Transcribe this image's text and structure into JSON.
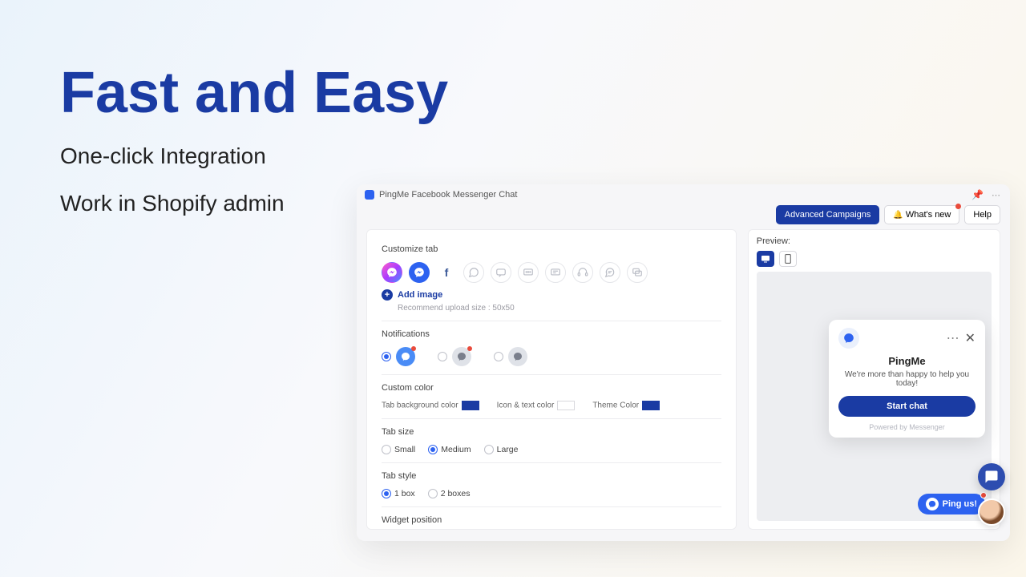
{
  "hero": {
    "headline": "Fast and Easy",
    "line1": "One-click Integration",
    "line2": "Work in Shopify admin"
  },
  "titlebar": {
    "app_name": "PingMe Facebook Messenger Chat"
  },
  "toolbar": {
    "advanced": "Advanced Campaigns",
    "whatsnew": "What's new",
    "help": "Help"
  },
  "sections": {
    "customize_tab": "Customize tab",
    "add_image": "Add image",
    "upload_hint": "Recommend upload size : 50x50",
    "notifications": "Notifications",
    "custom_color": "Custom color",
    "color_labels": {
      "tab_bg": "Tab background color",
      "icon_text": "Icon & text color",
      "theme": "Theme Color"
    },
    "tab_size": "Tab size",
    "sizes": {
      "small": "Small",
      "medium": "Medium",
      "large": "Large"
    },
    "tab_style": "Tab style",
    "styles": {
      "one": "1 box",
      "two": "2 boxes"
    },
    "widget_position": "Widget position"
  },
  "preview": {
    "label": "Preview:",
    "card": {
      "title": "PingMe",
      "subtitle": "We're more than happy to help you today!",
      "cta": "Start chat",
      "footer": "Powered by Messenger"
    },
    "pill": "Ping us!"
  },
  "colors": {
    "tab_bg": "#1a3ba3",
    "icon_text": "#ffffff",
    "theme": "#1a3ba3"
  },
  "selections": {
    "size": "medium",
    "style": "one",
    "notification_variant": 0
  }
}
